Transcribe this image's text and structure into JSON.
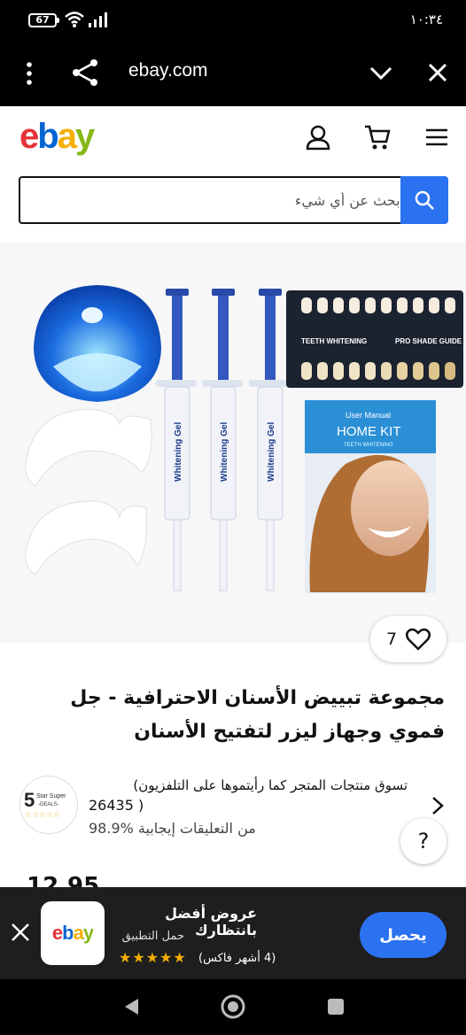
{
  "status_bar": {
    "battery": "67",
    "time": "١٠:٣٤"
  },
  "browser": {
    "url": "ebay.com"
  },
  "ebay": {
    "logo": {
      "e": "e",
      "b": "b",
      "a": "a",
      "y": "y"
    },
    "search_placeholder": "ابحث عن أي شيء"
  },
  "product": {
    "watch_count": "7",
    "title": "مجموعة تبييض الأسنان الاحترافية - جل فموي وجهاز ليزر لتفتيح الأسنان",
    "image_texts": {
      "syringe_label": "Whitening Gel",
      "shade_guide_left": "TEETH WHITENING",
      "shade_guide_right": "PRO SHADE GUIDE",
      "manual_header": "User Manual",
      "manual_title": "HOME KIT",
      "manual_sub": "TEETH WHITENING"
    },
    "price_peek": "12.95"
  },
  "seller": {
    "logo_line1": "5",
    "logo_line2": "Star Super",
    "logo_line3": "-DEALS-",
    "name": "تسوق منتجات المتجر كما رأيتموها على التلفزيون)",
    "count": "26435 )",
    "feedback": "98.9% من التعليقات إيجابية"
  },
  "help_label": "?",
  "app_banner": {
    "title": "عروض أفضل بانتظارك",
    "subtitle": "حمل التطبيق",
    "stars": "★★★★★",
    "rating_text": "(4 أشهر فاكس)",
    "get_button": "يحصل",
    "app_logo": "ebay"
  },
  "colors": {
    "accent": "#2b72f0",
    "logo_red": "#e53238",
    "logo_blue": "#0064d2",
    "logo_yellow": "#f5af02",
    "logo_green": "#86b817"
  }
}
